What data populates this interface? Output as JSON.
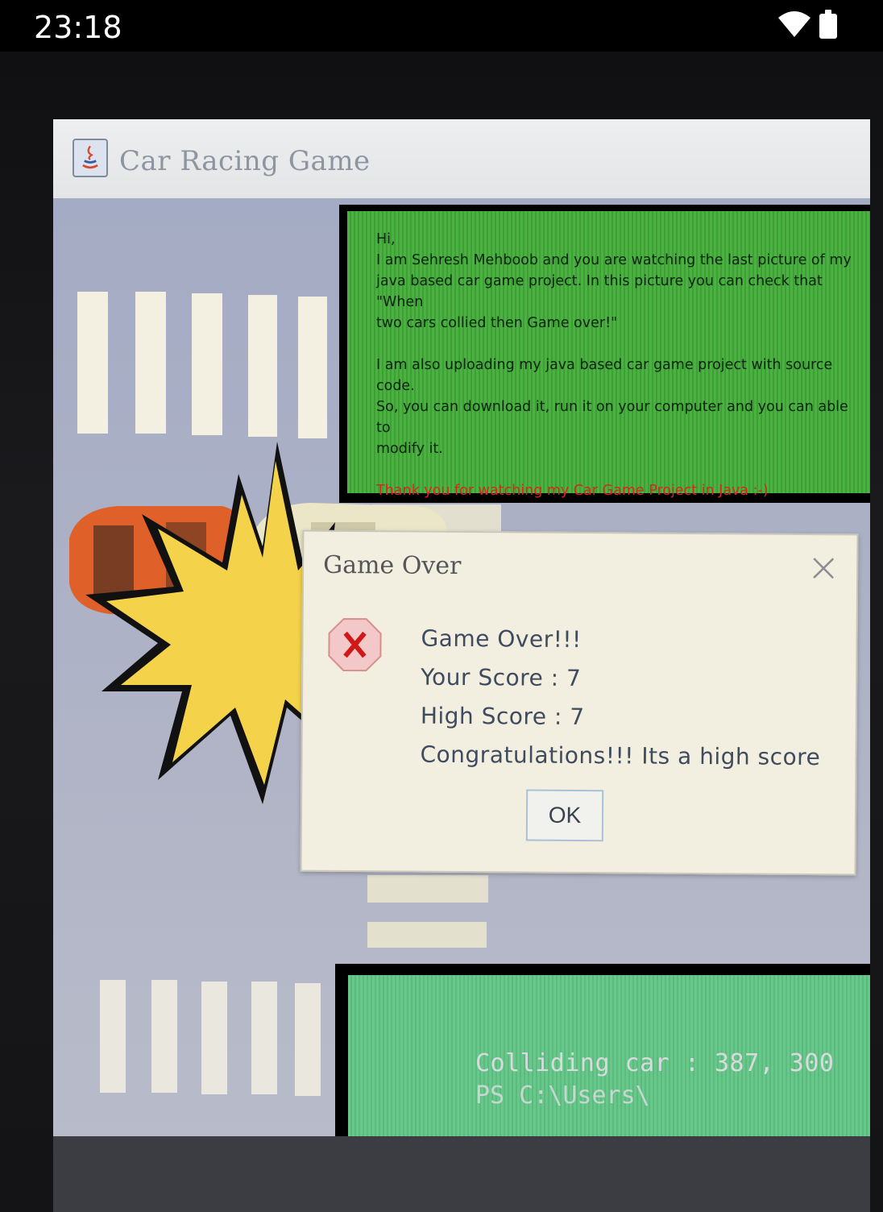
{
  "status_bar": {
    "time": "23:18",
    "icons": [
      "wifi-icon",
      "battery-icon"
    ]
  },
  "window": {
    "title": "Car Racing Game",
    "icon": "java-coffee-icon"
  },
  "info_panel": {
    "greeting": "Hi,",
    "lines": [
      "I am Sehresh Mehboob and you are watching the last picture of my",
      "java based car game project. In this picture you can check that \"When",
      "two cars collied then Game  over!\""
    ],
    "lines2": [
      "I am also uploading my java based car game project with source code.",
      "So, you can download it, run it on your computer and you can able to",
      "modify it."
    ],
    "thanks": "Thank you for watching my Car Game Project in Java :-)",
    "colors": {
      "background": "#4ab240",
      "text": "#0d2410",
      "thanks": "#d8261e"
    }
  },
  "dialog": {
    "title": "Game Over",
    "icon": "error-icon",
    "close_icon": "close-icon",
    "message_lines": [
      "Game Over!!!",
      "Your Score : 7",
      "High Score : 7",
      "Congratulations!!! Its a high score"
    ],
    "ok_label": "OK"
  },
  "console": {
    "line1": "Colliding car : 387, 300",
    "line2": "PS C:\\Users\\"
  }
}
